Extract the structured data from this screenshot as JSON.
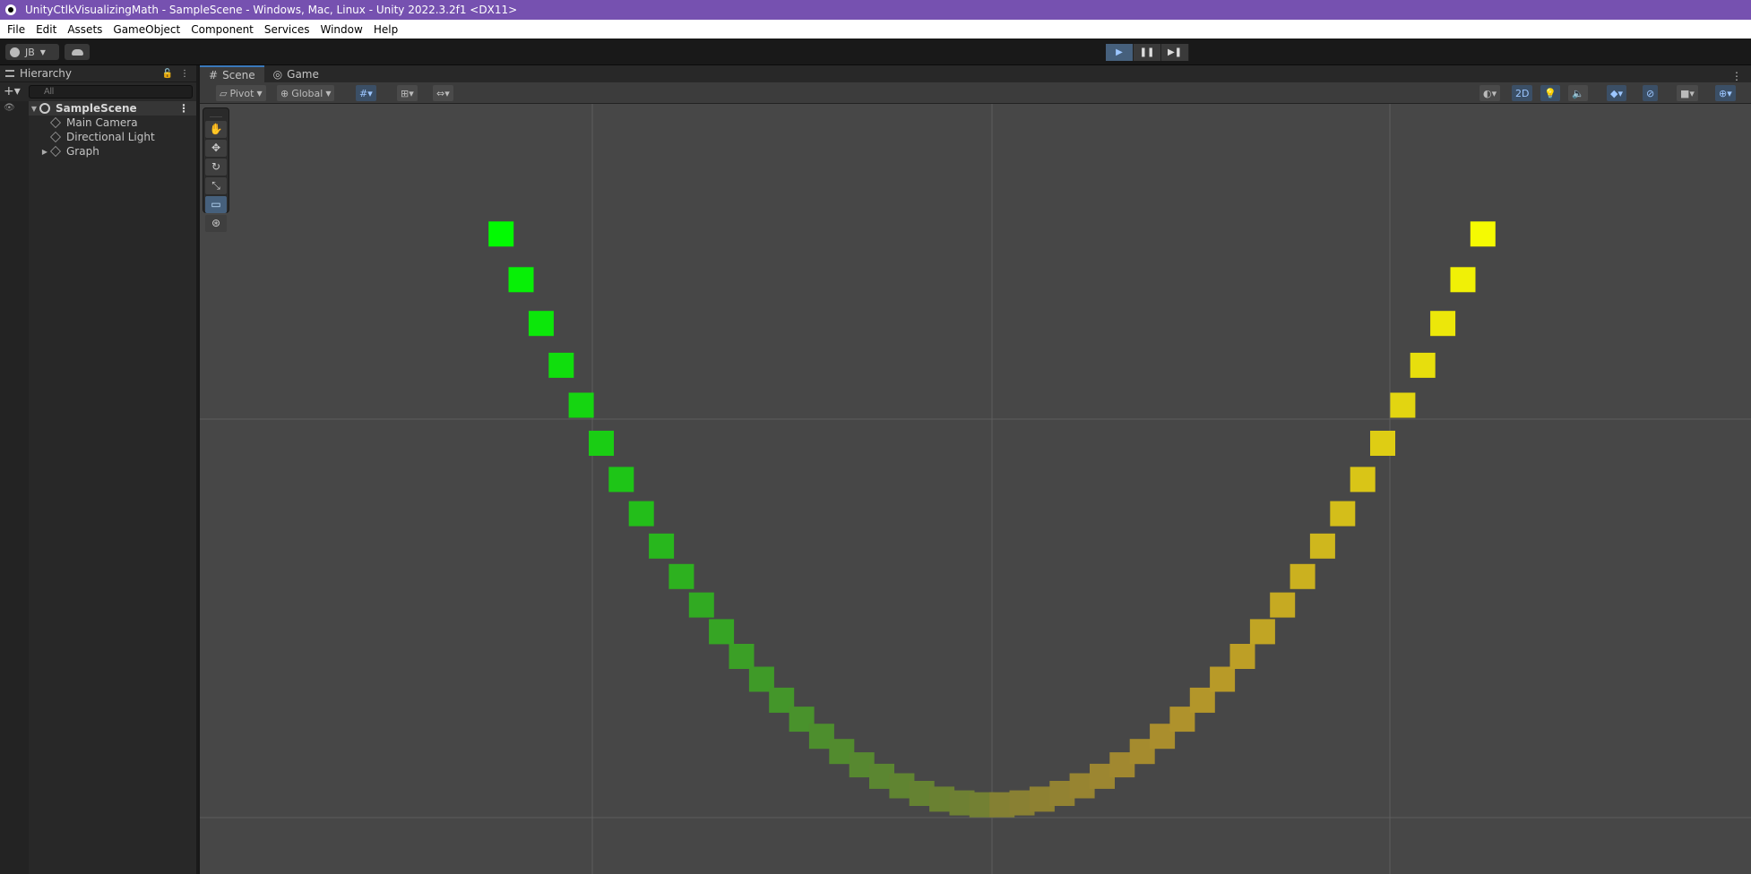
{
  "window": {
    "title": "UnityCtlkVisualizingMath - SampleScene - Windows, Mac, Linux - Unity 2022.3.2f1 <DX11>"
  },
  "menu": [
    "File",
    "Edit",
    "Assets",
    "GameObject",
    "Component",
    "Services",
    "Window",
    "Help"
  ],
  "toolbar": {
    "account_label": "JB",
    "play_icon": "play-icon",
    "pause_icon": "pause-icon",
    "step_icon": "step-icon",
    "play_active": true
  },
  "hierarchy": {
    "tab_label": "Hierarchy",
    "search_placeholder": "All",
    "scene_name": "SampleScene",
    "items": [
      {
        "label": "Main Camera",
        "expandable": false
      },
      {
        "label": "Directional Light",
        "expandable": false
      },
      {
        "label": "Graph",
        "expandable": true
      }
    ]
  },
  "scene": {
    "tabs": [
      {
        "label": "Scene",
        "active": true
      },
      {
        "label": "Game",
        "active": false
      }
    ],
    "pivot_label": "Pivot",
    "global_label": "Global",
    "mode_2d_label": "2D",
    "tools": [
      "hand-tool",
      "move-tool",
      "rotate-tool",
      "scale-tool",
      "rect-tool",
      "transform-tool"
    ],
    "active_tool": "rect-tool",
    "background_color": "#474747",
    "grid_color": "#5e5e5e"
  },
  "graph_points": {
    "count": 50,
    "function": "y = x^2",
    "x_range": [
      -1,
      1
    ],
    "color_low_left": "#0a2a1e",
    "color_top_left": "#00ff33",
    "color_top_right": "#ffff33",
    "color_low_right": "#2a2a1e"
  }
}
